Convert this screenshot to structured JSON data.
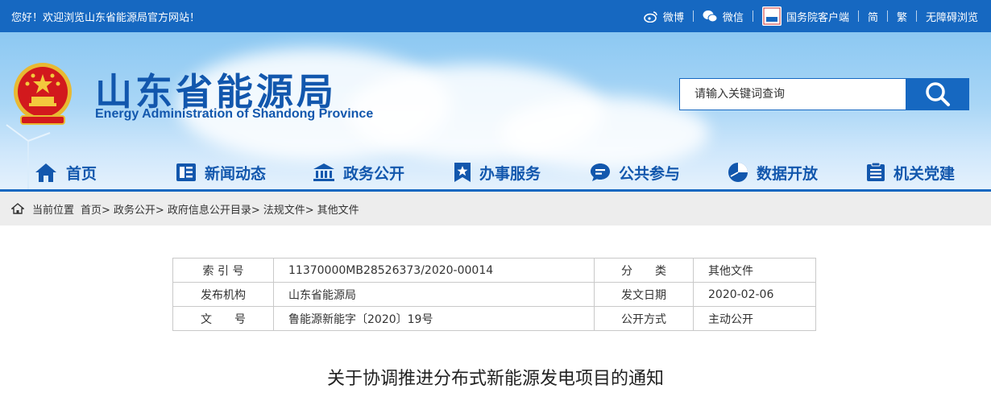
{
  "topbar": {
    "welcome": "您好！欢迎浏览山东省能源局官方网站！",
    "weibo": "微博",
    "wechat": "微信",
    "gov_badge": "国务院",
    "gov_client": "国务院客户端",
    "simplified": "简",
    "traditional": "繁",
    "accessible": "无障碍浏览"
  },
  "banner": {
    "title_cn": "山东省能源局",
    "title_en": "Energy Administration of Shandong Province",
    "search_placeholder": "请输入关键词查询"
  },
  "nav": {
    "items": [
      {
        "label": "首页",
        "icon": "home-icon"
      },
      {
        "label": "新闻动态",
        "icon": "newspaper-icon"
      },
      {
        "label": "政务公开",
        "icon": "government-building-icon"
      },
      {
        "label": "办事服务",
        "icon": "bookmark-star-icon"
      },
      {
        "label": "公共参与",
        "icon": "chat-bubble-icon"
      },
      {
        "label": "数据开放",
        "icon": "pie-chart-icon"
      },
      {
        "label": "机关党建",
        "icon": "document-list-icon"
      }
    ]
  },
  "breadcrumb": {
    "prefix": "当前位置",
    "items": [
      "首页>",
      "政务公开>",
      "政府信息公开目录>",
      "法规文件>",
      "其他文件"
    ]
  },
  "info": {
    "index_label": "索 引 号",
    "index_value": "11370000MB28526373/2020-00014",
    "category_label": "分　　类",
    "category_value": "其他文件",
    "publisher_label": "发布机构",
    "publisher_value": "山东省能源局",
    "date_label": "发文日期",
    "date_value": "2020-02-06",
    "docno_label": "文　　号",
    "docno_value": "鲁能源新能字〔2020〕19号",
    "mode_label": "公开方式",
    "mode_value": "主动公开"
  },
  "document": {
    "title": "关于协调推进分布式新能源发电项目的通知"
  },
  "colors": {
    "primary": "#1668c1",
    "title_blue": "#1257ad",
    "crumb_bg": "#ededed"
  }
}
